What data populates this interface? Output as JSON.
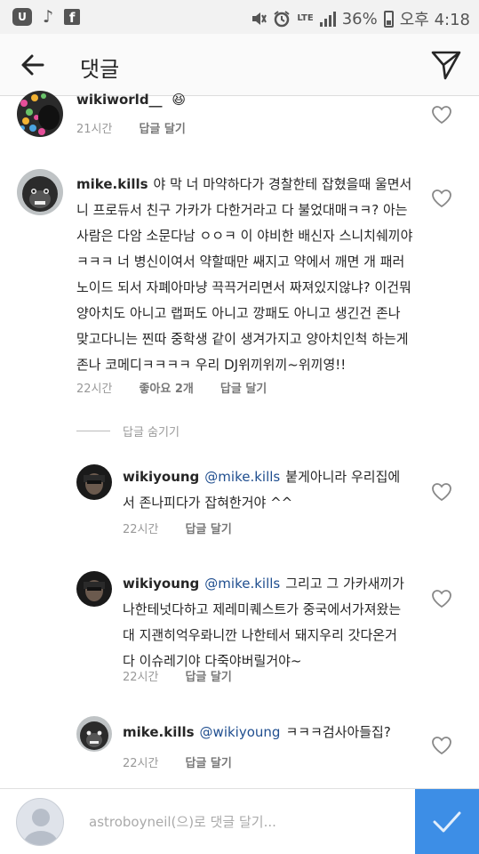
{
  "status_bar": {
    "left_icons": [
      "u-app-icon",
      "tiktok-icon",
      "facebook-icon"
    ],
    "lte": "LTE",
    "battery": "36%",
    "time": "오후 4:18",
    "accent": "#555555"
  },
  "header": {
    "title": "댓글",
    "back_icon": "back-arrow-icon",
    "send_icon": "paper-plane-icon"
  },
  "comments": [
    {
      "username": "wikiworld__",
      "emoji": "😆",
      "time": "21시간",
      "reply_label": "답글 달기"
    },
    {
      "username": "mike.kills",
      "text": "야 막 너 마약하다가 경찰한테 잡혔을때 울면서 니 프로듀서 친구 가카가 다한거라고 다 불었대매ㅋㅋ? 아는 사람은 다암 소문다남 ㅇㅇㅋ 이 야비한 배신자 스니치쉐끼야ㅋㅋㅋ 너 병신이여서 약할때만 쌔지고 약에서 깨면 개 패러노이드 되서 자폐아마냥 끅끅거리면서 짜져있지않냐? 이건뭐 양아치도 아니고 랩퍼도 아니고 깡패도 아니고 생긴건 존나 맞고다니는 찐따 중학생 같이 생겨가지고 양아치인척 하는게 존나 코메디ㅋㅋㅋㅋ 우리 DJ위끼위끼~위끼영!!",
      "time": "22시간",
      "likes": "좋아요 2개",
      "reply_label": "답글 달기"
    }
  ],
  "hide_replies_label": "답글 숨기기",
  "replies": [
    {
      "username": "wikiyoung",
      "mention": "@mike.kills",
      "text": "붙게아니라 우리집에서 존나피다가 잡혀한거야 ^^",
      "time": "22시간",
      "reply_label": "답글 달기"
    },
    {
      "username": "wikiyoung",
      "mention": "@mike.kills",
      "text": "그리고 그 가카새끼가 나한테넛다하고 제레미퀘스트가 중국에서가져왔는대 지괜히억우롸니깐 나한테서 돼지우리 갓다온거다 이슈레기야 다죽야버릴거야~",
      "time": "22시간",
      "reply_label": "답글 달기"
    },
    {
      "username": "mike.kills",
      "mention": "@wikiyoung",
      "text": "ㅋㅋㅋ검사아들집?",
      "time": "22시간",
      "reply_label": "답글 달기"
    }
  ],
  "composer": {
    "placeholder": "astroboyneil(으)로 댓글 달기...",
    "post_color": "#3d8ee6",
    "post_icon": "checkmark-icon"
  },
  "colors": {
    "mention": "#1f4e8f",
    "meta": "#999999",
    "header_bg": "#fafafa"
  }
}
